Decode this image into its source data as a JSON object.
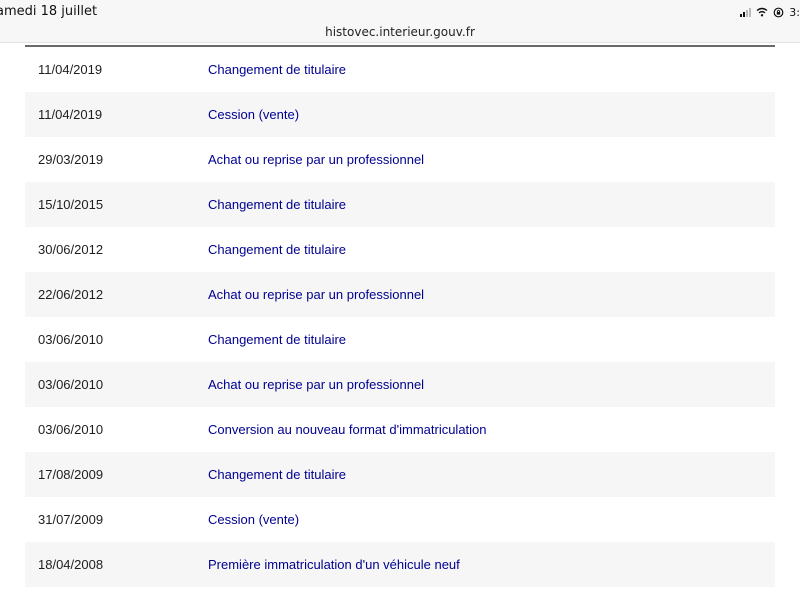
{
  "status_bar": {
    "date": "amedi 18 juillet",
    "battery_text": "3:",
    "icons": [
      "signal-icon",
      "wifi-icon",
      "orientation-lock-icon"
    ]
  },
  "browser": {
    "url": "histovec.interieur.gouv.fr"
  },
  "colors": {
    "link": "#000091",
    "row_alt": "#f6f6f6",
    "header_rule": "#6a6a6a"
  },
  "history": {
    "rows": [
      {
        "date": "11/04/2019",
        "event": "Changement de titulaire"
      },
      {
        "date": "11/04/2019",
        "event": "Cession (vente)"
      },
      {
        "date": "29/03/2019",
        "event": "Achat ou reprise par un professionnel"
      },
      {
        "date": "15/10/2015",
        "event": "Changement de titulaire"
      },
      {
        "date": "30/06/2012",
        "event": "Changement de titulaire"
      },
      {
        "date": "22/06/2012",
        "event": "Achat ou reprise par un professionnel"
      },
      {
        "date": "03/06/2010",
        "event": "Changement de titulaire"
      },
      {
        "date": "03/06/2010",
        "event": "Achat ou reprise par un professionnel"
      },
      {
        "date": "03/06/2010",
        "event": "Conversion au nouveau format d'immatriculation"
      },
      {
        "date": "17/08/2009",
        "event": "Changement de titulaire"
      },
      {
        "date": "31/07/2009",
        "event": "Cession (vente)"
      },
      {
        "date": "18/04/2008",
        "event": "Première immatriculation d'un véhicule neuf"
      }
    ]
  }
}
